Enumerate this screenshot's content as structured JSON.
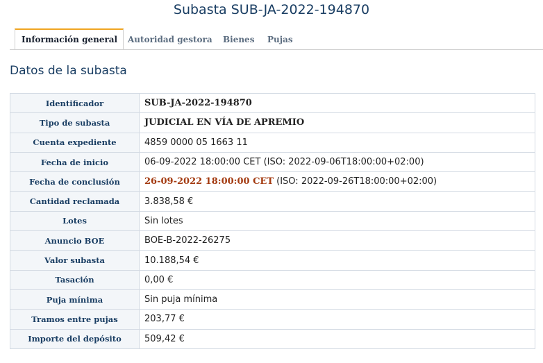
{
  "page": {
    "title": "Subasta SUB-JA-2022-194870"
  },
  "tabs": [
    {
      "label": "Información general",
      "active": true
    },
    {
      "label": "Autoridad gestora",
      "active": false
    },
    {
      "label": "Bienes",
      "active": false
    },
    {
      "label": "Pujas",
      "active": false
    }
  ],
  "section": {
    "title": "Datos de la subasta"
  },
  "rows": {
    "identificador": {
      "label": "Identificador",
      "value": "SUB-JA-2022-194870"
    },
    "tipo": {
      "label": "Tipo de subasta",
      "value": "JUDICIAL EN VÍA DE APREMIO"
    },
    "cuenta": {
      "label": "Cuenta expediente",
      "value": "4859 0000 05 1663 11"
    },
    "inicio": {
      "label": "Fecha de inicio",
      "value": "06-09-2022 18:00:00 CET (ISO: 2022-09-06T18:00:00+02:00)"
    },
    "conclusion": {
      "label": "Fecha de conclusión",
      "value_highlight": "26-09-2022 18:00:00 CET",
      "value_rest": " (ISO: 2022-09-26T18:00:00+02:00)"
    },
    "cantidad": {
      "label": "Cantidad reclamada",
      "value": "3.838,58 €"
    },
    "lotes": {
      "label": "Lotes",
      "value": "Sin lotes"
    },
    "boe": {
      "label": "Anuncio BOE",
      "value": "BOE-B-2022-26275"
    },
    "valor": {
      "label": "Valor subasta",
      "value": "10.188,54 €"
    },
    "tasacion": {
      "label": "Tasación",
      "value": "0,00 €"
    },
    "puja_minima": {
      "label": "Puja mínima",
      "value": "Sin puja mínima"
    },
    "tramos": {
      "label": "Tramos entre pujas",
      "value": "203,77 €"
    },
    "deposito": {
      "label": "Importe del depósito",
      "value": "509,42 €"
    }
  },
  "colors": {
    "accent_tab": "#f0a521",
    "highlight_date": "#a33a10",
    "heading": "#1a3e63"
  }
}
